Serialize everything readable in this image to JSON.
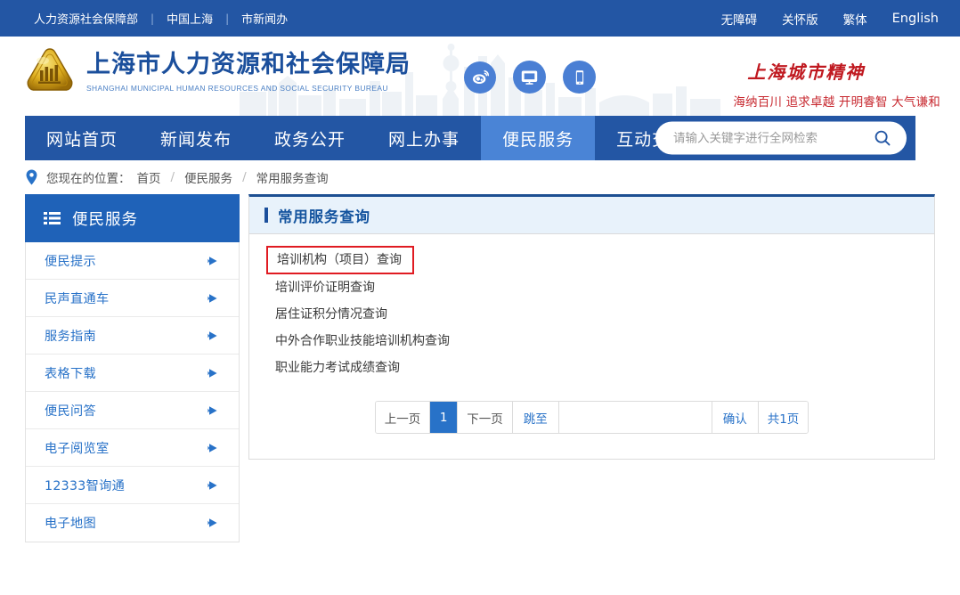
{
  "topbar": {
    "links": [
      "人力资源社会保障部",
      "中国上海",
      "市新闻办"
    ],
    "separator": "|",
    "tools": [
      "无障碍",
      "关怀版",
      "繁体",
      "English"
    ]
  },
  "banner": {
    "title_cn": "上海市人力资源和社会保障局",
    "title_en": "SHANGHAI MUNICIPAL HUMAN RESOURCES AND SOCIAL SECURITY BUREAU",
    "social": [
      "weibo-icon",
      "desktop-icon",
      "mobile-icon"
    ],
    "spirit_title": "上海城市精神",
    "spirit_sub": "海纳百川 追求卓越 开明睿智 大气谦和"
  },
  "nav": {
    "items": [
      {
        "label": "网站首页",
        "active": false
      },
      {
        "label": "新闻发布",
        "active": false
      },
      {
        "label": "政务公开",
        "active": false
      },
      {
        "label": "网上办事",
        "active": false
      },
      {
        "label": "便民服务",
        "active": true
      },
      {
        "label": "互动交流",
        "active": false
      }
    ],
    "search_placeholder": "请输入关键字进行全网检索",
    "search_value": ""
  },
  "breadcrumb": {
    "label": "您现在的位置：",
    "items": [
      "首页",
      "便民服务",
      "常用服务查询"
    ],
    "separator": "/"
  },
  "sidebar": {
    "title": "便民服务",
    "items": [
      {
        "label": "便民提示"
      },
      {
        "label": "民声直通车"
      },
      {
        "label": "服务指南"
      },
      {
        "label": "表格下载"
      },
      {
        "label": "便民问答"
      },
      {
        "label": "电子阅览室"
      },
      {
        "label": "12333智询通"
      },
      {
        "label": "电子地图"
      }
    ]
  },
  "content": {
    "title": "常用服务查询",
    "services": [
      {
        "label": "培训机构（项目）查询",
        "highlighted": true
      },
      {
        "label": "培训评价证明查询",
        "highlighted": false
      },
      {
        "label": "居住证积分情况查询",
        "highlighted": false
      },
      {
        "label": "中外合作职业技能培训机构查询",
        "highlighted": false
      },
      {
        "label": "职业能力考试成绩查询",
        "highlighted": false
      }
    ],
    "pagination": {
      "prev": "上一页",
      "current_page": "1",
      "next": "下一页",
      "jump": "跳至",
      "jump_value": "",
      "confirm": "确认",
      "total": "共1页"
    }
  },
  "colors": {
    "brand_blue": "#2356a4",
    "nav_active": "#4a84d6",
    "link_blue": "#2872c8",
    "highlight_red": "#e01b22",
    "spirit_red": "#c01920"
  }
}
